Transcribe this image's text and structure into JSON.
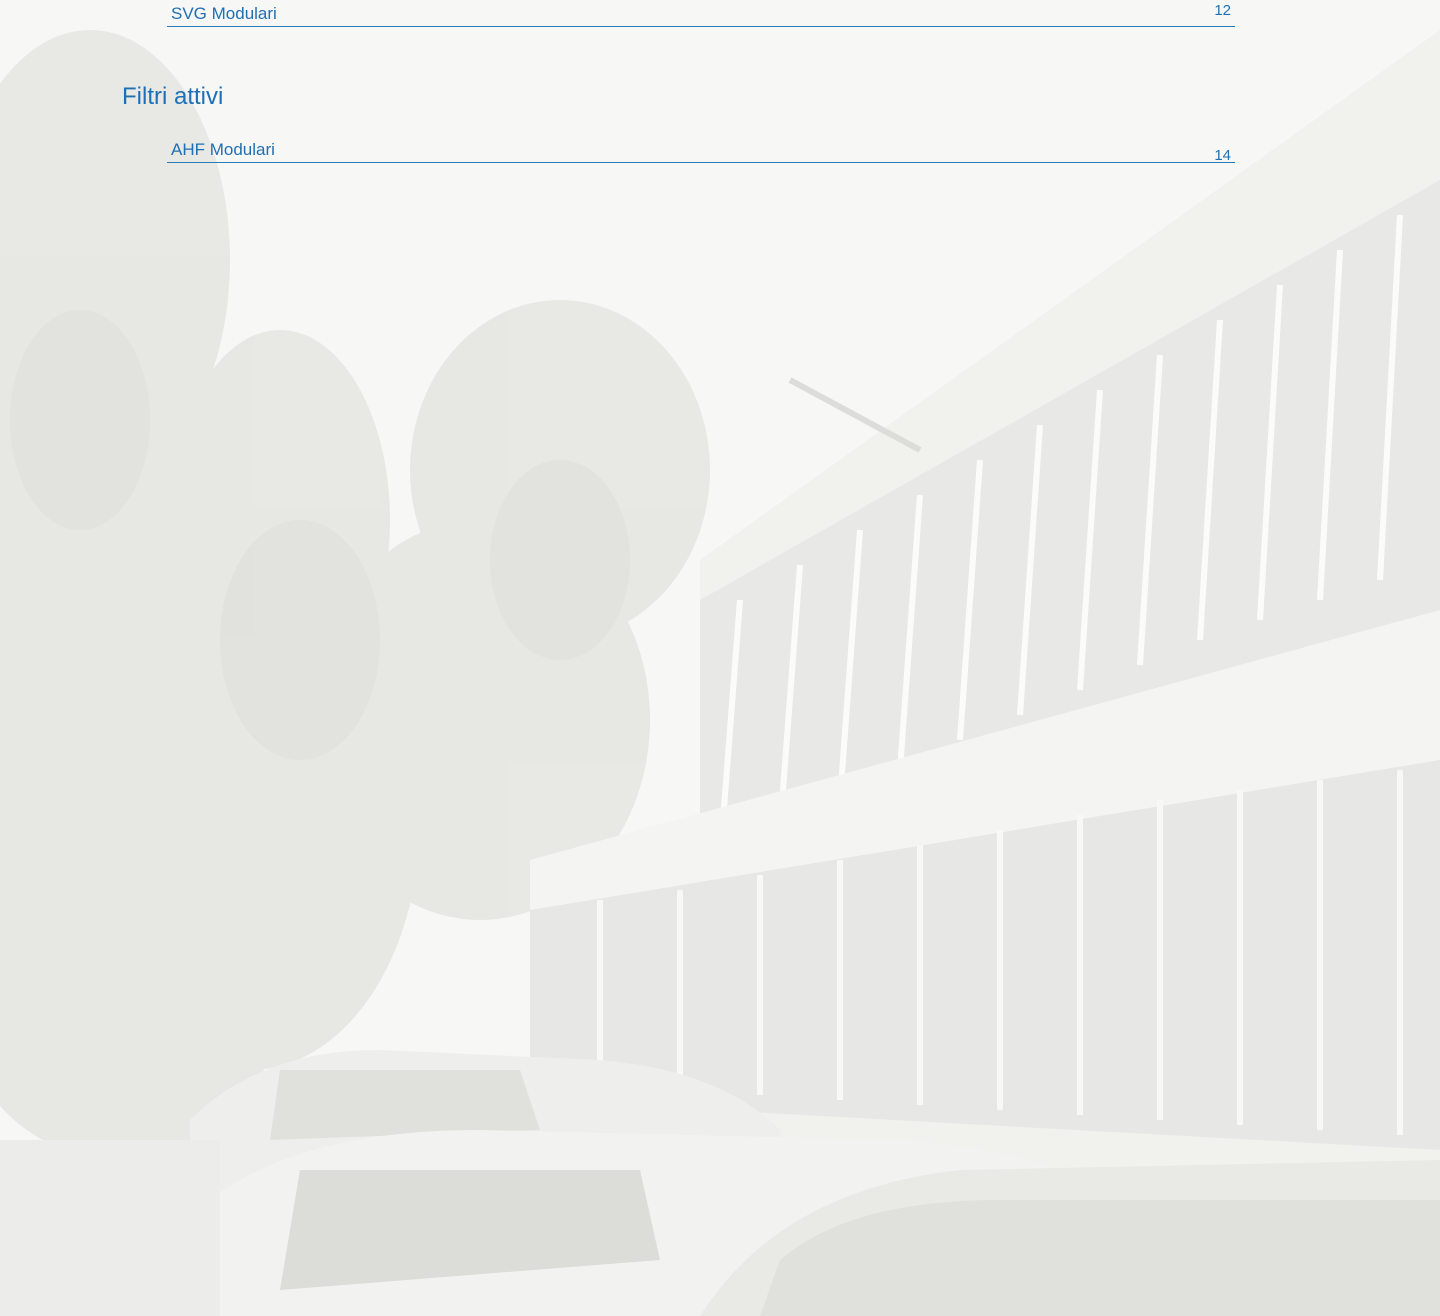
{
  "toc": {
    "entries": [
      {
        "label": "SVG Modulari",
        "page": "12"
      },
      {
        "label": "AHF Modulari",
        "page": "14"
      }
    ],
    "section_heading": "Filtri attivi"
  },
  "colors": {
    "accent": "#1e6fb5",
    "rule": "#2b7ab8"
  }
}
